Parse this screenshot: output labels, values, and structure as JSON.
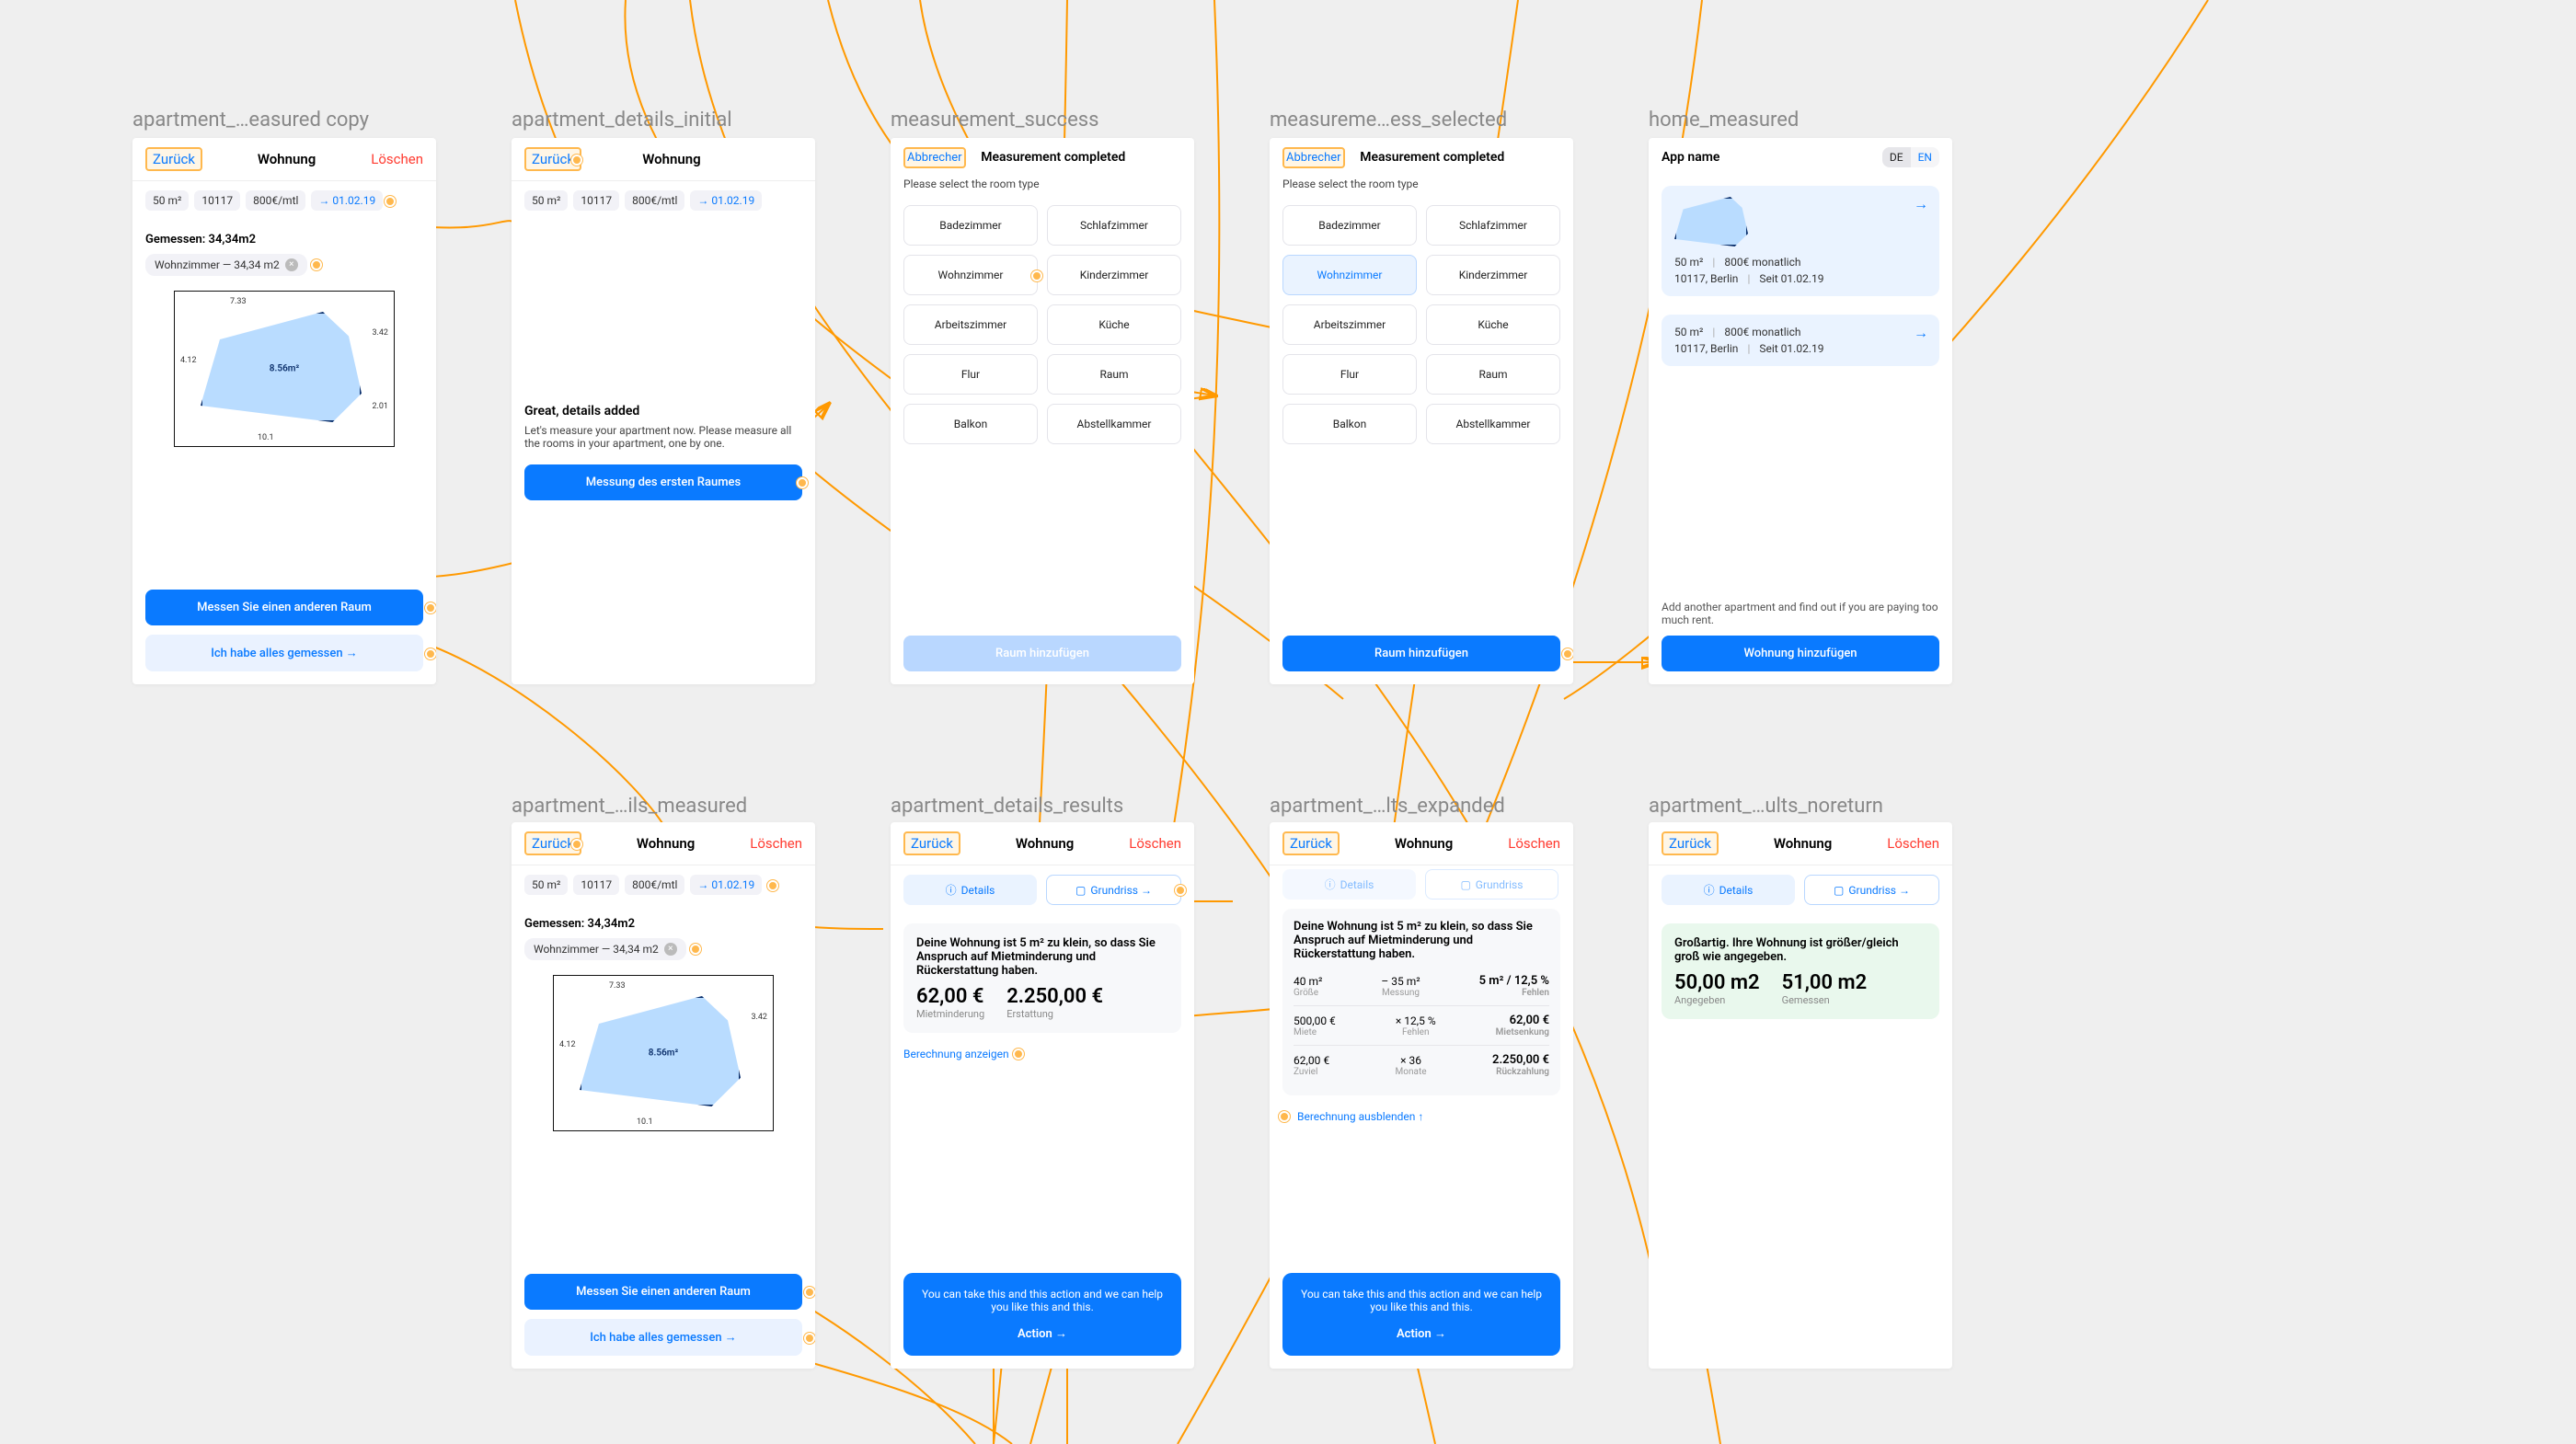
{
  "frames": {
    "f1": "apartment_…easured copy",
    "f2": "apartment_details_initial",
    "f3": "measurement_success",
    "f4": "measureme…ess_selected",
    "f5": "home_measured",
    "f6": "apartment_…ils_measured",
    "f7": "apartment_details_results",
    "f8": "apartment_…lts_expanded",
    "f9": "apartment_…ults_noreturn"
  },
  "nav": {
    "back": "Zurück",
    "cancel": "Abbrecher",
    "title": "Wohnung",
    "delete": "Löschen"
  },
  "chips": {
    "size": "50 m²",
    "zip": "10117",
    "rent": "800€/mtl",
    "date": "→ 01.02.19"
  },
  "measured": {
    "heading": "Gemessen: 34,34m2",
    "roomchip": "Wohnzimmer — 34,34 m2",
    "planlabel": "8.56m²",
    "btn_another": "Messen Sie einen anderen Raum",
    "btn_done": "Ich habe alles gemessen →"
  },
  "initial": {
    "title": "Great, details added",
    "body": "Let's measure your apartment now. Please measure all the rooms in your apartment, one by one.",
    "btn": "Messung des ersten Raumes"
  },
  "roomselect": {
    "headline": "Measurement completed",
    "prompt": "Please select the room type",
    "rooms": [
      "Badezimmer",
      "Schlafzimmer",
      "Wohnzimmer",
      "Kinderzimmer",
      "Arbeitszimmer",
      "Küche",
      "Flur",
      "Raum",
      "Balkon",
      "Abstellkammer"
    ],
    "btn_add": "Raum hinzufügen"
  },
  "home": {
    "appname": "App name",
    "lang_de": "DE",
    "lang_en": "EN",
    "meta1a": "50 m²",
    "meta1b": "800€ monatlich",
    "meta2a": "10117, Berlin",
    "meta2b": "Seit 01.02.19",
    "footer": "Add another apartment and find out if you are paying too much rent.",
    "btn": "Wohnung hinzufügen"
  },
  "results": {
    "seg_details": "Details",
    "seg_plan": "Grundriss →",
    "title": "Deine Wohnung ist 5 m² zu klein, so dass Sie Anspruch auf Mietminderung und Rückerstattung haben.",
    "val1": "62,00 €",
    "lbl1": "Mietminderung",
    "val2": "2.250,00 €",
    "lbl2": "Erstattung",
    "link_show": "Berechnung anzeigen",
    "action_msg": "You can take this and this action and we can help you like this and this.",
    "action_btn": "Action →"
  },
  "expanded": {
    "r1a": "40 m²",
    "r1al": "Größe",
    "r1b": "35 m²",
    "r1bl": "Messung",
    "r1c": "5 m² / 12,5 %",
    "r1cl": "Fehlen",
    "r2a": "500,00 €",
    "r2al": "Miete",
    "r2b": "12,5 %",
    "r2bl": "Fehlen",
    "r2c": "62,00 €",
    "r2cl": "Mietsenkung",
    "r3a": "62,00 €",
    "r3al": "Zuviel",
    "r3b": "36",
    "r3bl": "Monate",
    "r3c": "2.250,00 €",
    "r3cl": "Rückzahlung",
    "link_hide": "Berechnung ausblenden ↑"
  },
  "noreturn": {
    "title": "Großartig. Ihre Wohnung ist größer/gleich groß wie angegeben.",
    "v1": "50,00 m2",
    "l1": "Angegeben",
    "v2": "51,00 m2",
    "l2": "Gemessen"
  }
}
